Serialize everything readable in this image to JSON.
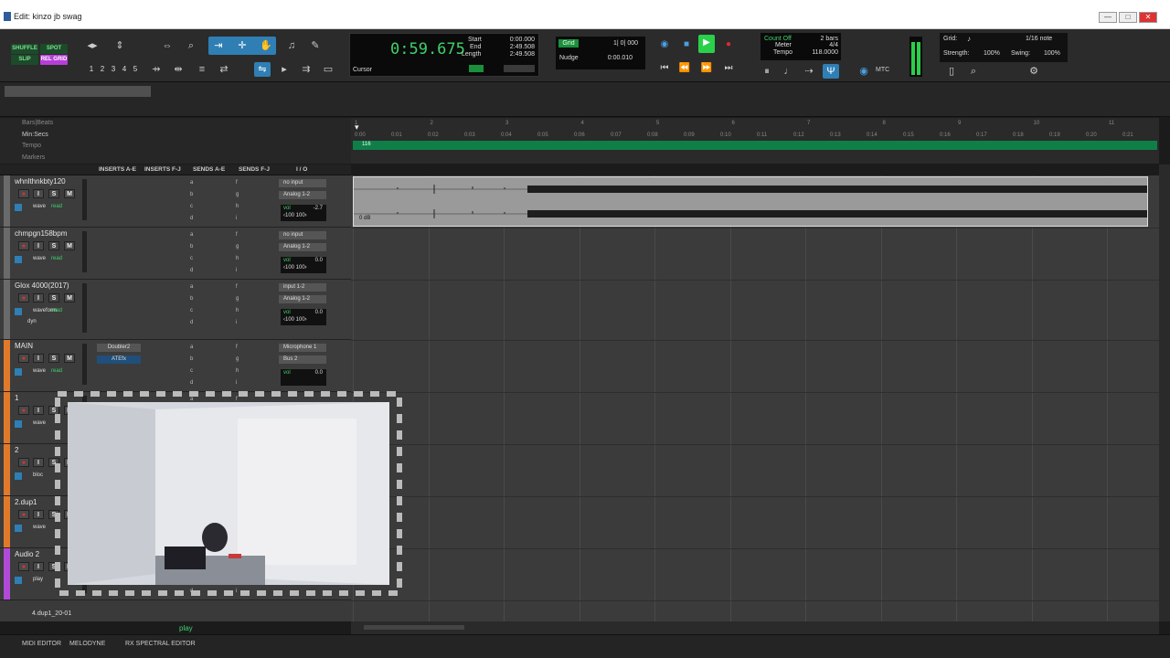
{
  "window": {
    "title": "Edit: kinzo jb swag",
    "controls": [
      "—",
      "□",
      "✕"
    ]
  },
  "toolbar": {
    "modes": [
      "SHUFFLE",
      "SPOT",
      "SLIP",
      "REL GRID"
    ],
    "zoom_presets": [
      "1",
      "2",
      "3",
      "4",
      "5"
    ],
    "counter": {
      "main": "0:59.675",
      "start_label": "Start",
      "end_label": "End",
      "length_label": "Length",
      "start": "0:00.000",
      "end": "2:49.508",
      "length": "2:49.508",
      "cursor_label": "Cursor"
    },
    "grid": {
      "label": "Grid",
      "value": "1| 0| 000",
      "nudge_label": "Nudge",
      "nudge_value": "0:00.010"
    },
    "countoff": {
      "label": "Count Off",
      "meter_label": "Meter",
      "tempo_label": "Tempo",
      "bars": "2 bars",
      "meter": "4/4",
      "tempo": "118.0000"
    },
    "mtc": "MTC",
    "gridsettings": {
      "grid_label": "Grid:",
      "grid_value": "1/16 note",
      "strength_label": "Strength:",
      "strength": "100%",
      "swing_label": "Swing:",
      "swing": "100%"
    }
  },
  "rulers": {
    "bars": "Bars|Beats",
    "minsecs": "Min:Secs",
    "tempo": "Tempo",
    "markers": "Markers",
    "tempo_value": "116",
    "bar_ticks": [
      "1",
      "2",
      "3",
      "4",
      "5",
      "6",
      "7",
      "8",
      "9",
      "10",
      "11"
    ],
    "sec_ticks": [
      "0:00",
      "0:01",
      "0:02",
      "0:03",
      "0:04",
      "0:05",
      "0:06",
      "0:07",
      "0:08",
      "0:09",
      "0:10",
      "0:11",
      "0:12",
      "0:13",
      "0:14",
      "0:15",
      "0:16",
      "0:17",
      "0:18",
      "0:19",
      "0:20",
      "0:21"
    ]
  },
  "columns": [
    "INSERTS A-E",
    "INSERTS F-J",
    "SENDS A-E",
    "SENDS F-J",
    "I / O"
  ],
  "tracks": [
    {
      "name": "whnlthnkbty120",
      "color": "#6a6a6a",
      "io1": "no input",
      "io2": "Analog 1-2",
      "vol": "-2.7",
      "pan": "‹100  100›",
      "view": "wave",
      "mode": "read"
    },
    {
      "name": "chmpgn158bpm",
      "color": "#6a6a6a",
      "io1": "no input",
      "io2": "Analog 1-2",
      "vol": "0.0",
      "pan": "‹100  100›",
      "view": "wave",
      "mode": "read"
    },
    {
      "name": "Glox 4000(2017)",
      "color": "#6a6a6a",
      "io1": "input 1-2",
      "io2": "Analog 1-2",
      "vol": "0.0",
      "pan": "‹100  100›",
      "view": "waveform",
      "mode": "read",
      "extra": "dyn"
    },
    {
      "name": "MAIN",
      "color": "#e07a2a",
      "io1": "Microphone 1",
      "io2": "Bus 2",
      "vol": "0.0",
      "ins1": "Doubler2",
      "ins2": "ATEfx",
      "view": "wave",
      "mode": "read"
    },
    {
      "name": "1",
      "color": "#e07a2a",
      "view": "wave"
    },
    {
      "name": "2",
      "color": "#e07a2a",
      "view": "bloc"
    },
    {
      "name": "2.dup1",
      "color": "#e07a2a",
      "view": "wave"
    },
    {
      "name": "Audio 2",
      "color": "#b24ad8",
      "view": "play"
    }
  ],
  "clip": {
    "gain": "0 dB"
  },
  "footer_track": {
    "name": "4.dup1_20-01",
    "play": "play"
  },
  "bottom_tabs": [
    "MIDI EDITOR",
    "MELODYNE",
    "RX SPECTRAL EDITOR"
  ],
  "colors": {
    "accent": "#2f7fb5",
    "green": "#3fd26a",
    "tempo": "#0f7f47"
  }
}
